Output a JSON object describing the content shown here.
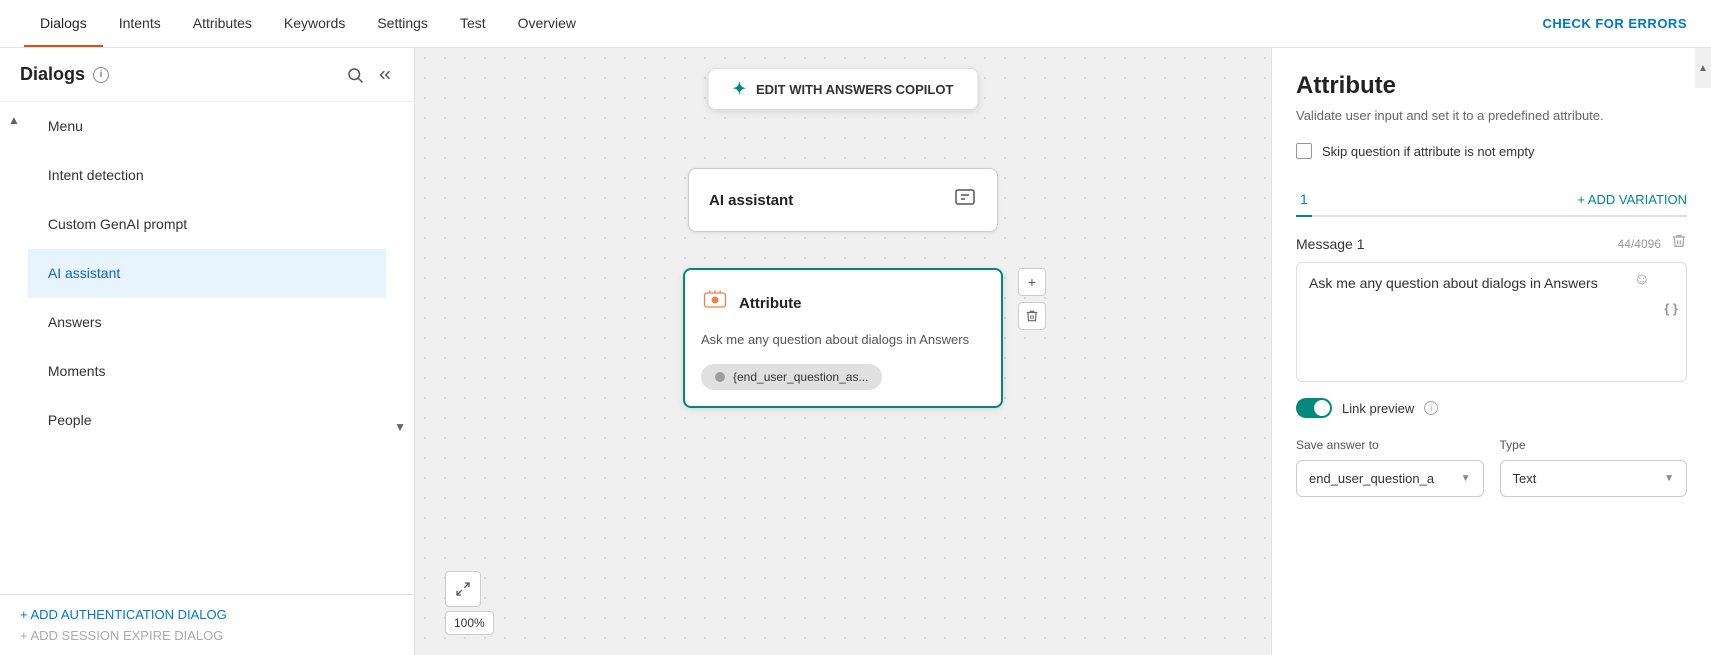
{
  "nav": {
    "tabs": [
      {
        "label": "Dialogs",
        "active": true
      },
      {
        "label": "Intents",
        "active": false
      },
      {
        "label": "Attributes",
        "active": false
      },
      {
        "label": "Keywords",
        "active": false
      },
      {
        "label": "Settings",
        "active": false
      },
      {
        "label": "Test",
        "active": false
      },
      {
        "label": "Overview",
        "active": false
      }
    ],
    "check_errors": "CHECK FOR ERRORS"
  },
  "sidebar": {
    "title": "Dialogs",
    "items": [
      {
        "label": "Menu",
        "active": false
      },
      {
        "label": "Intent detection",
        "active": false
      },
      {
        "label": "Custom GenAI prompt",
        "active": false
      },
      {
        "label": "AI assistant",
        "active": true
      },
      {
        "label": "Answers",
        "active": false
      },
      {
        "label": "Moments",
        "active": false
      },
      {
        "label": "People",
        "active": false
      }
    ],
    "add_auth_label": "+ ADD AUTHENTICATION DIALOG",
    "add_session_label": "+ ADD SESSION EXPIRE DIALOG"
  },
  "canvas": {
    "copilot_label": "EDIT WITH ANSWERS COPILOT",
    "node_ai": {
      "title": "AI assistant"
    },
    "node_attr": {
      "title": "Attribute",
      "text": "Ask me any question about dialogs in Answers",
      "pill": "{end_user_question_as..."
    },
    "zoom": "100%"
  },
  "panel": {
    "title": "Attribute",
    "subtitle": "Validate user input and set it to a predefined attribute.",
    "skip_label": "Skip question if attribute is not empty",
    "variation_tab": "1",
    "add_variation": "+ ADD VARIATION",
    "message_label": "Message 1",
    "message_count": "44/4096",
    "message_text": "Ask me any question about dialogs in Answers",
    "link_preview_label": "Link preview",
    "save_answer_label": "Save answer to",
    "save_answer_value": "end_user_question_a",
    "type_label": "Type",
    "type_value": "Text"
  }
}
